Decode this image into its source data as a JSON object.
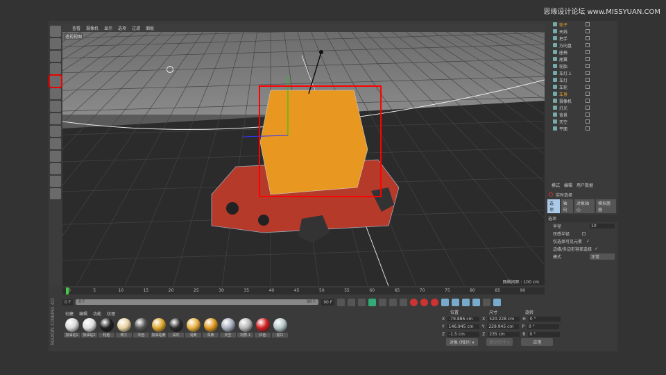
{
  "watermark": "思缘设计论坛 www.MISSYUAN.COM",
  "viewport": {
    "menu": [
      "查看",
      "摄像机",
      "显示",
      "选项",
      "过滤",
      "面板"
    ],
    "view_label": "透视视图",
    "grid_spacing": "网格间距 : 100 cm",
    "selection_color": "#ff0000"
  },
  "objects": [
    {
      "name": "轮子"
    },
    {
      "name": "天线"
    },
    {
      "name": "把手"
    },
    {
      "name": "方向盘"
    },
    {
      "name": "座椅"
    },
    {
      "name": "尾翼"
    },
    {
      "name": "轮胎"
    },
    {
      "name": "车灯.1"
    },
    {
      "name": "车灯"
    },
    {
      "name": "车轮"
    },
    {
      "name": "车身"
    },
    {
      "name": "摄像机"
    },
    {
      "name": "灯光"
    },
    {
      "name": "背景"
    },
    {
      "name": "天空"
    },
    {
      "name": "平面"
    }
  ],
  "attributes": {
    "menu": [
      "模式",
      "编辑",
      "用户数据"
    ],
    "tool": "实时选择",
    "tabs": [
      "选项",
      "轴向",
      "对象轴心",
      "模拟菌器"
    ],
    "section": "选项",
    "radius_label": "半径",
    "radius": "10",
    "pressure_label": "压感半径",
    "visible_only_label": "仅选择可见元素",
    "tolerance_label": "边缘/多边形容差选择",
    "mode_label": "模式",
    "mode": "正常",
    "check": "✓"
  },
  "timeline": {
    "ticks": [
      "0",
      "5",
      "10",
      "15",
      "20",
      "25",
      "30",
      "35",
      "40",
      "45",
      "50",
      "55",
      "60",
      "65",
      "70",
      "75",
      "80",
      "85",
      "90"
    ],
    "current": "0 F",
    "start": "0 F",
    "bar_start": "0 F",
    "bar_end": "90 F",
    "end": "90 F"
  },
  "materials": {
    "menu": [
      "创建",
      "编辑",
      "功能",
      "纹理"
    ],
    "brand": "MAXON CINEMA 4D",
    "items": [
      {
        "name": "加油站1",
        "color": "#d8d8d8"
      },
      {
        "name": "加油站2",
        "color": "#e0e0e0"
      },
      {
        "name": "轮胎",
        "color": "#202020"
      },
      {
        "name": "椅子",
        "color": "#e8d2a0"
      },
      {
        "name": "灰色",
        "color": "#555555"
      },
      {
        "name": "加油站黄",
        "color": "#e0a830"
      },
      {
        "name": "深灰",
        "color": "#2a2a2a"
      },
      {
        "name": "浅黄",
        "color": "#e8b040"
      },
      {
        "name": "深黄",
        "color": "#e09a20"
      },
      {
        "name": "天空",
        "color": "#aab0c0"
      },
      {
        "name": "材质.1",
        "color": "#b8b8b8"
      },
      {
        "name": "红色",
        "color": "#d02020"
      },
      {
        "name": "窗口",
        "color": "#b8c8c8"
      }
    ]
  },
  "coords": {
    "headers": [
      "位置",
      "尺寸",
      "旋转"
    ],
    "rows": [
      {
        "axis": "X",
        "pos": "-79.886 cm",
        "size": "520.228 cm",
        "rot_axis": "H",
        "rot": "0 °"
      },
      {
        "axis": "Y",
        "pos": "146.945 cm",
        "size": "229.945 cm",
        "rot_axis": "P",
        "rot": "0 °"
      },
      {
        "axis": "Z",
        "pos": "-1.5 cm",
        "size": "235 cm",
        "rot_axis": "B",
        "rot": "0 °"
      }
    ],
    "mode": "对象 (相对) ▾",
    "size_mode": "绝对尺寸 ▾",
    "apply": "应用"
  }
}
